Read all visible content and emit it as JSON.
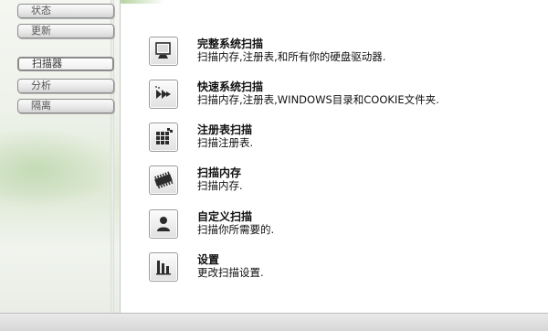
{
  "sidebar": {
    "items": [
      {
        "label": "状态"
      },
      {
        "label": "更新"
      },
      {
        "label": "扫描器",
        "active": true
      },
      {
        "label": "分析"
      },
      {
        "label": "隔离"
      }
    ]
  },
  "main": {
    "items": [
      {
        "icon": "monitor-icon",
        "title": "完整系统扫描",
        "desc": "扫描内存,注册表,和所有你的硬盘驱动器."
      },
      {
        "icon": "fast-forward-arrows-icon",
        "title": "快速系统扫描",
        "desc": "扫描内存,注册表,WINDOWS目录和COOKIE文件夹."
      },
      {
        "icon": "registry-grid-icon",
        "title": "注册表扫描",
        "desc": "扫描注册表."
      },
      {
        "icon": "memory-chip-icon",
        "title": "扫描内存",
        "desc": "扫描内存."
      },
      {
        "icon": "user-icon",
        "title": "自定义扫描",
        "desc": "扫描你所需要的."
      },
      {
        "icon": "bar-chart-settings-icon",
        "title": "设置",
        "desc": "更改扫描设置."
      }
    ]
  },
  "colors": {
    "accent_orange": "#f39a1e",
    "sidebar_green": "#dfe9d6",
    "icon_dark": "#2b2b2b"
  }
}
